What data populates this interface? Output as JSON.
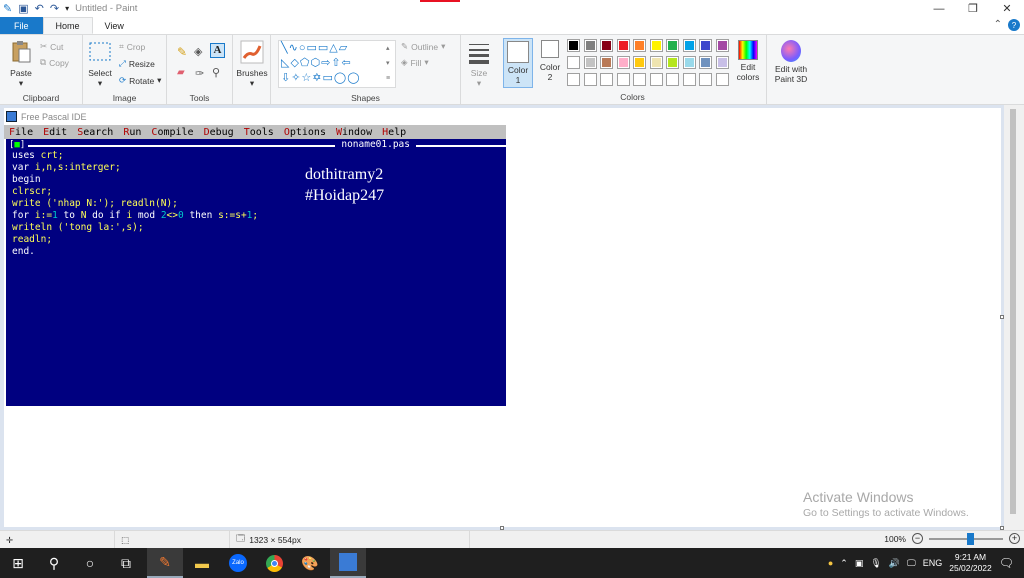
{
  "window": {
    "title": "Untitled - Paint"
  },
  "tabs": [
    "File",
    "Home",
    "View"
  ],
  "ribbon": {
    "clipboard": {
      "label": "Clipboard",
      "paste": "Paste",
      "cut": "Cut",
      "copy": "Copy"
    },
    "image": {
      "label": "Image",
      "select": "Select",
      "crop": "Crop",
      "resize": "Resize",
      "rotate": "Rotate"
    },
    "tools": {
      "label": "Tools"
    },
    "brushes": {
      "label": "Brushes"
    },
    "shapes": {
      "label": "Shapes",
      "outline": "Outline",
      "fill": "Fill"
    },
    "size": {
      "label": "Size"
    },
    "color1": {
      "label": "Color",
      "num": "1"
    },
    "color2": {
      "label": "Color",
      "num": "2"
    },
    "colors": {
      "label": "Colors"
    },
    "edit_colors": {
      "line1": "Edit",
      "line2": "colors"
    },
    "paint3d": {
      "line1": "Edit with",
      "line2": "Paint 3D"
    },
    "palette_row1": [
      "#000000",
      "#7f7f7f",
      "#880015",
      "#ed1c24",
      "#ff7f27",
      "#fff200",
      "#22b14c",
      "#00a2e8",
      "#3f48cc",
      "#a349a4"
    ],
    "palette_row2": [
      "#ffffff",
      "#c3c3c3",
      "#b97a57",
      "#ffaec9",
      "#ffc90e",
      "#efe4b0",
      "#b5e61d",
      "#99d9ea",
      "#7092be",
      "#c8bfe7"
    ]
  },
  "freepascal": {
    "title": "Free Pascal IDE",
    "menu": [
      "File",
      "Edit",
      "Search",
      "Run",
      "Compile",
      "Debug",
      "Tools",
      "Options",
      "Window",
      "Help"
    ],
    "filename": "noname01.pas",
    "close_btn": "[",
    "close_mark": "■",
    "close_end": "]",
    "code": {
      "l1a": "uses ",
      "l1b": "crt;",
      "l2a": "var ",
      "l2b": "i,n,s:interger;",
      "l3": "begin",
      "l4": "clrscr;",
      "l5a": "write ",
      "l5b": "('nhap N:'); readln(N);",
      "l6a": "for ",
      "l6b": "i:=",
      "l6c": "1",
      "l6d": " to ",
      "l6e": "N",
      "l6f": " do if ",
      "l6g": "i",
      "l6h": " mod ",
      "l6i": "2",
      "l6j": "<>",
      "l6k": "0",
      "l6l": " then ",
      "l6m": "s:=s+",
      "l6n": "1",
      "l6o": ";",
      "l7": "writeln ('tong la:',s);",
      "l8": "readln;",
      "l9": "end."
    },
    "watermark_line1": "dothitramy2",
    "watermark_line2": "#Hoidap247"
  },
  "activate": {
    "line1": "Activate Windows",
    "line2": "Go to Settings to activate Windows."
  },
  "status": {
    "dimensions": "1323 × 554px",
    "zoom": "100%",
    "zoom_minus": "−",
    "zoom_plus": "+"
  },
  "taskbar": {
    "time": "9:21 AM",
    "date": "25/02/2022",
    "lang": "ENG"
  }
}
